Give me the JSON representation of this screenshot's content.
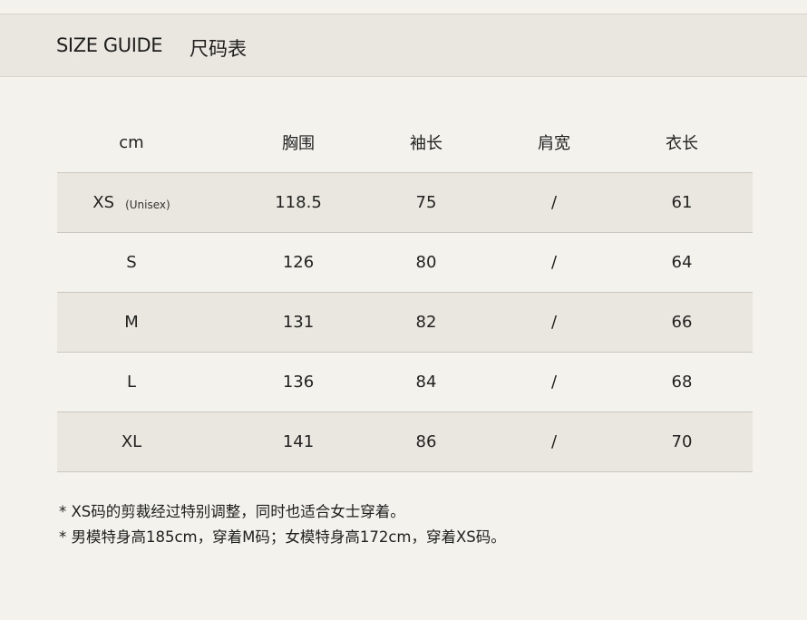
{
  "header": {
    "title_en": "SIZE GUIDE",
    "title_cn": "尺码表"
  },
  "table": {
    "columns": [
      "cm",
      "胸围",
      "袖长",
      "肩宽",
      "衣长"
    ],
    "rows": [
      {
        "size": "XS",
        "note": "(Unisex)",
        "values": [
          "118.5",
          "75",
          "/",
          "61"
        ]
      },
      {
        "size": "S",
        "values": [
          "126",
          "80",
          "/",
          "64"
        ]
      },
      {
        "size": "M",
        "values": [
          "131",
          "82",
          "/",
          "66"
        ]
      },
      {
        "size": "L",
        "values": [
          "136",
          "84",
          "/",
          "68"
        ]
      },
      {
        "size": "XL",
        "values": [
          "141",
          "86",
          "/",
          "70"
        ]
      }
    ]
  },
  "notes": [
    "* XS码的剪裁经过特别调整，同时也适合女士穿着。",
    "* 男模特身高185cm，穿着M码；女模特身高172cm，穿着XS码。"
  ]
}
